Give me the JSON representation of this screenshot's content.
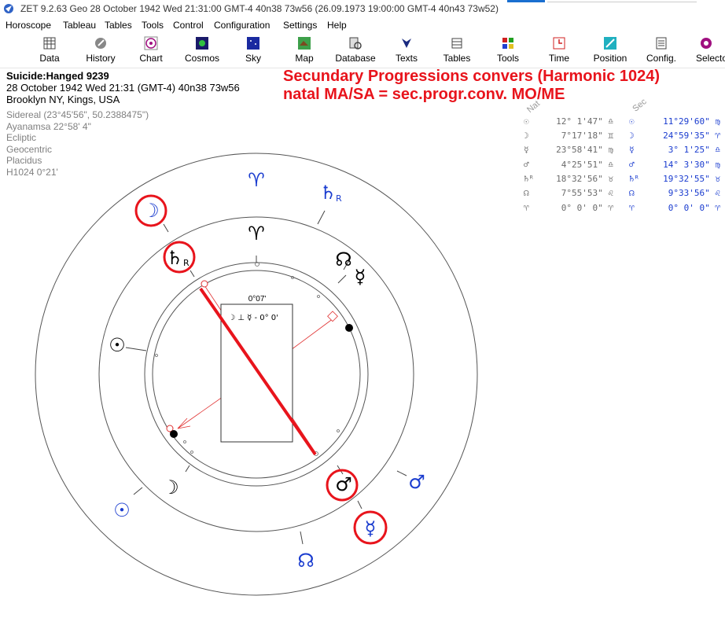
{
  "window": {
    "title": "ZET 9.2.63 Geo   28 October 1942  Wed  21:31:00 GMT-4 40n38  73w56  (26.09.1973  19:00:00 GMT-4 40n43 73w52)"
  },
  "menu": [
    "Horoscope",
    "Tableau",
    "Tables",
    "Tools",
    "Control",
    "Configuration",
    "Settings",
    "Help"
  ],
  "toolbar": [
    {
      "label": "Data",
      "icon": "data-icon"
    },
    {
      "label": "History",
      "icon": "history-icon"
    },
    {
      "label": "Chart",
      "icon": "chart-icon"
    },
    {
      "label": "Cosmos",
      "icon": "cosmos-icon"
    },
    {
      "label": "Sky",
      "icon": "sky-icon"
    },
    {
      "label": "Map",
      "icon": "map-icon"
    },
    {
      "label": "Database",
      "icon": "database-icon"
    },
    {
      "label": "Texts",
      "icon": "texts-icon"
    },
    {
      "label": "Tables",
      "icon": "tables-icon"
    },
    {
      "label": "Tools",
      "icon": "tools-icon"
    },
    {
      "label": "Time",
      "icon": "time-icon"
    },
    {
      "label": "Position",
      "icon": "position-icon"
    },
    {
      "label": "Config.",
      "icon": "config-icon"
    },
    {
      "label": "Selecto",
      "icon": "selector-icon"
    }
  ],
  "info": {
    "name": "Suicide:Hanged 9239",
    "date_line": "28 October 1942  Wed  21:31 (GMT-4) 40n38  73w56",
    "place": "Brooklyn NY, Kings, USA",
    "sidereal": "Sidereal (23°45'56\", 50.2388475\")",
    "ayanamsa": "Ayanamsa 22°58' 4\"",
    "coord": "Ecliptic",
    "centric": "Geocentric",
    "houses": "Placidus",
    "harmonic": "H1024   0°21'"
  },
  "overlay": {
    "line1": "Secundary Progressions convers (Harmonic 1024)",
    "line2": "natal MA/SA = sec.progr.conv. MO/ME"
  },
  "positions": {
    "header_natal": "Nat",
    "header_sec": "Sec",
    "rows": [
      {
        "ng": "☉",
        "nv": "12° 1'47\" ♎",
        "sg": "☉",
        "sv": "11°29'60\" ♍"
      },
      {
        "ng": "☽",
        "nv": "7°17'18\" ♊",
        "sg": "☽",
        "sv": "24°59'35\" ♈"
      },
      {
        "ng": "☿",
        "nv": "23°58'41\" ♍",
        "sg": "☿",
        "sv": "3° 1'25\" ♎"
      },
      {
        "ng": "♂",
        "nv": "4°25'51\" ♎",
        "sg": "♂",
        "sv": "14° 3'30\" ♍"
      },
      {
        "ng": "♄ᴿ",
        "nv": "18°32'56\" ♉",
        "sg": "♄ᴿ",
        "sv": "19°32'55\" ♉"
      },
      {
        "ng": "☊",
        "nv": "7°55'53\" ♌",
        "sg": "☊",
        "sv": "9°33'56\" ♌"
      },
      {
        "ng": "♈",
        "nv": "0° 0' 0\" ♈",
        "sg": "♈",
        "sv": "0° 0' 0\" ♈"
      }
    ]
  },
  "wheel": {
    "center_box_label": "0°07'",
    "center_aspect": "☽ ⊥ ☿  - 0° 0'",
    "outer_glyphs": [
      {
        "g": "♈",
        "name": "sec-aries-glyph"
      },
      {
        "g": "♄",
        "sub": "R",
        "name": "sec-saturn-glyph"
      },
      {
        "g": "☽",
        "name": "sec-moon-glyph"
      },
      {
        "g": "☉",
        "name": "sec-sun-glyph"
      },
      {
        "g": "☊",
        "name": "sec-node-glyph"
      },
      {
        "g": "☿",
        "name": "sec-mercury-glyph"
      },
      {
        "g": "♂",
        "name": "sec-mars-glyph"
      }
    ],
    "inner_glyphs": [
      {
        "g": "♈",
        "name": "natal-aries-glyph"
      },
      {
        "g": "♄",
        "sub": "R",
        "name": "natal-saturn-glyph"
      },
      {
        "g": "☉",
        "name": "natal-sun-glyph"
      },
      {
        "g": "☽",
        "name": "natal-moon-glyph"
      },
      {
        "g": "☊",
        "name": "natal-node-glyph"
      },
      {
        "g": "☿",
        "name": "natal-mercury-glyph"
      },
      {
        "g": "♂",
        "name": "natal-mars-glyph"
      }
    ]
  },
  "colors": {
    "annotation_red": "#e8141c",
    "sec_blue": "#1a3ccf",
    "aspect_red": "#e03030"
  }
}
